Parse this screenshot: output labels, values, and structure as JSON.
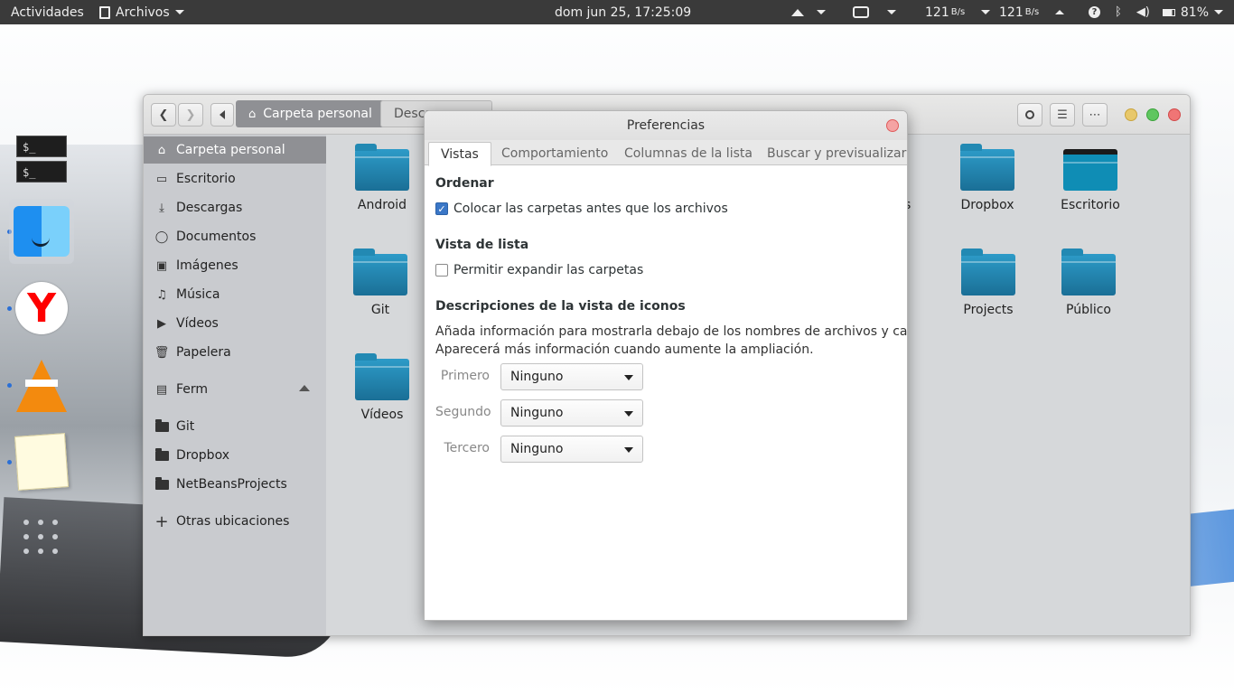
{
  "topbar": {
    "activities": "Actividades",
    "app_menu": "Archivos",
    "clock": "dom jun 25, 17:25:09",
    "net_down": "121",
    "net_down_unit": "B/s",
    "net_up": "121",
    "net_up_unit": "B/s",
    "battery": "81%"
  },
  "dock": {
    "terminal_prompt_1": "$_",
    "terminal_prompt_2": "$_"
  },
  "window": {
    "breadcrumb_active": "Carpeta personal",
    "breadcrumb_next": "Descargas",
    "sidebar": [
      {
        "label": "Carpeta personal",
        "icon": "home-icon"
      },
      {
        "label": "Escritorio",
        "icon": "desktop-icon"
      },
      {
        "label": "Descargas",
        "icon": "download-icon"
      },
      {
        "label": "Documentos",
        "icon": "document-icon"
      },
      {
        "label": "Imágenes",
        "icon": "image-icon"
      },
      {
        "label": "Música",
        "icon": "music-icon"
      },
      {
        "label": "Vídeos",
        "icon": "video-icon"
      },
      {
        "label": "Papelera",
        "icon": "trash-icon"
      },
      {
        "label": "Ferm",
        "icon": "drive-icon"
      },
      {
        "label": "Git",
        "icon": "folder-icon"
      },
      {
        "label": "Dropbox",
        "icon": "folder-icon"
      },
      {
        "label": "NetBeansProjects",
        "icon": "folder-icon"
      },
      {
        "label": "Otras ubicaciones",
        "icon": "plus-icon"
      }
    ],
    "files": [
      "Android",
      "Git",
      "Vídeos",
      "tos",
      "Dropbox",
      "Escritorio",
      "s",
      "Projects",
      "Público"
    ]
  },
  "dialog": {
    "title": "Preferencias",
    "tabs": [
      "Vistas",
      "Comportamiento",
      "Columnas de la lista",
      "Buscar y previsualizar"
    ],
    "ordenar_heading": "Ordenar",
    "folders_first_label": "Colocar las carpetas antes que los archivos",
    "folders_first_checked": true,
    "list_view_heading": "Vista de lista",
    "expand_folders_label": "Permitir expandir las carpetas",
    "expand_folders_checked": false,
    "icon_captions_heading": "Descripciones de la vista de iconos",
    "icon_captions_desc_1": "Añada información para mostrarla debajo de los nombres de archivos y carpetas.",
    "icon_captions_desc_2": "Aparecerá más información cuando aumente la ampliación.",
    "captions": [
      {
        "label": "Primero",
        "value": "Ninguno"
      },
      {
        "label": "Segundo",
        "value": "Ninguno"
      },
      {
        "label": "Tercero",
        "value": "Ninguno"
      }
    ]
  },
  "colors": {
    "topbar_bg": "#3a3a3a",
    "selection": "#8f9094",
    "checkbox_accent": "#3a77c7",
    "folder_teal": "#1a86b4"
  }
}
